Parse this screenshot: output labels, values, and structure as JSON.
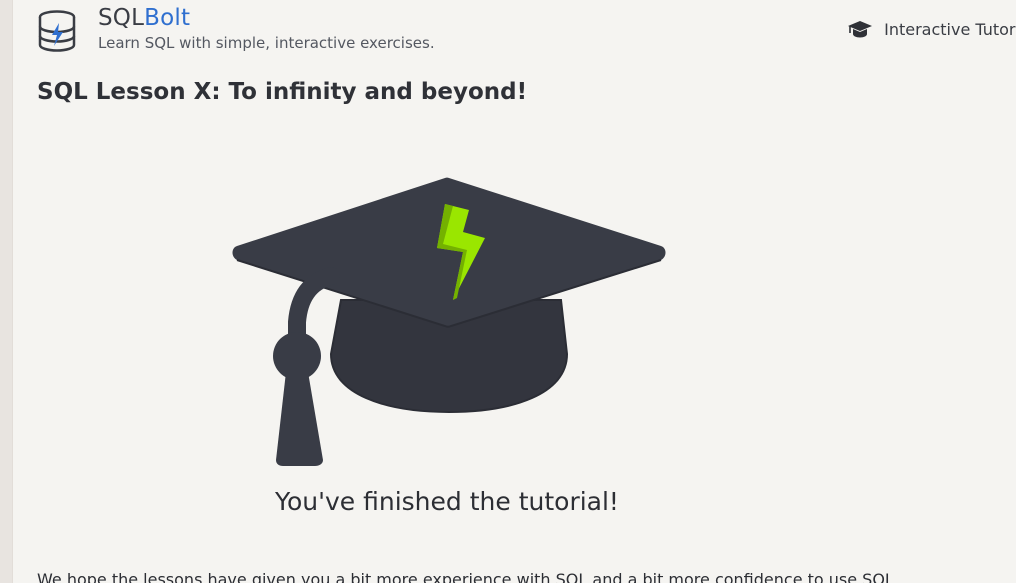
{
  "header": {
    "brand_sql": "SQL",
    "brand_bolt": "Bolt",
    "tagline": "Learn SQL with simple, interactive exercises.",
    "nav_label": "Interactive Tutorial",
    "logo_icon": "database-bolt-icon",
    "nav_icon": "graduation-cap-icon"
  },
  "lesson": {
    "title": "SQL Lesson X: To infinity and beyond!",
    "illustration_icon": "graduation-cap-bolt-icon",
    "finished_text": "You've finished the tutorial!",
    "paragraph": "We hope the lessons have given you a bit more experience with SQL and a bit more confidence to use SQL"
  },
  "colors": {
    "background": "#f5f4f1",
    "text": "#2f3137",
    "brand_blue": "#2f6fcf",
    "cap_dark": "#373a43",
    "bolt_green": "#9ae600"
  }
}
